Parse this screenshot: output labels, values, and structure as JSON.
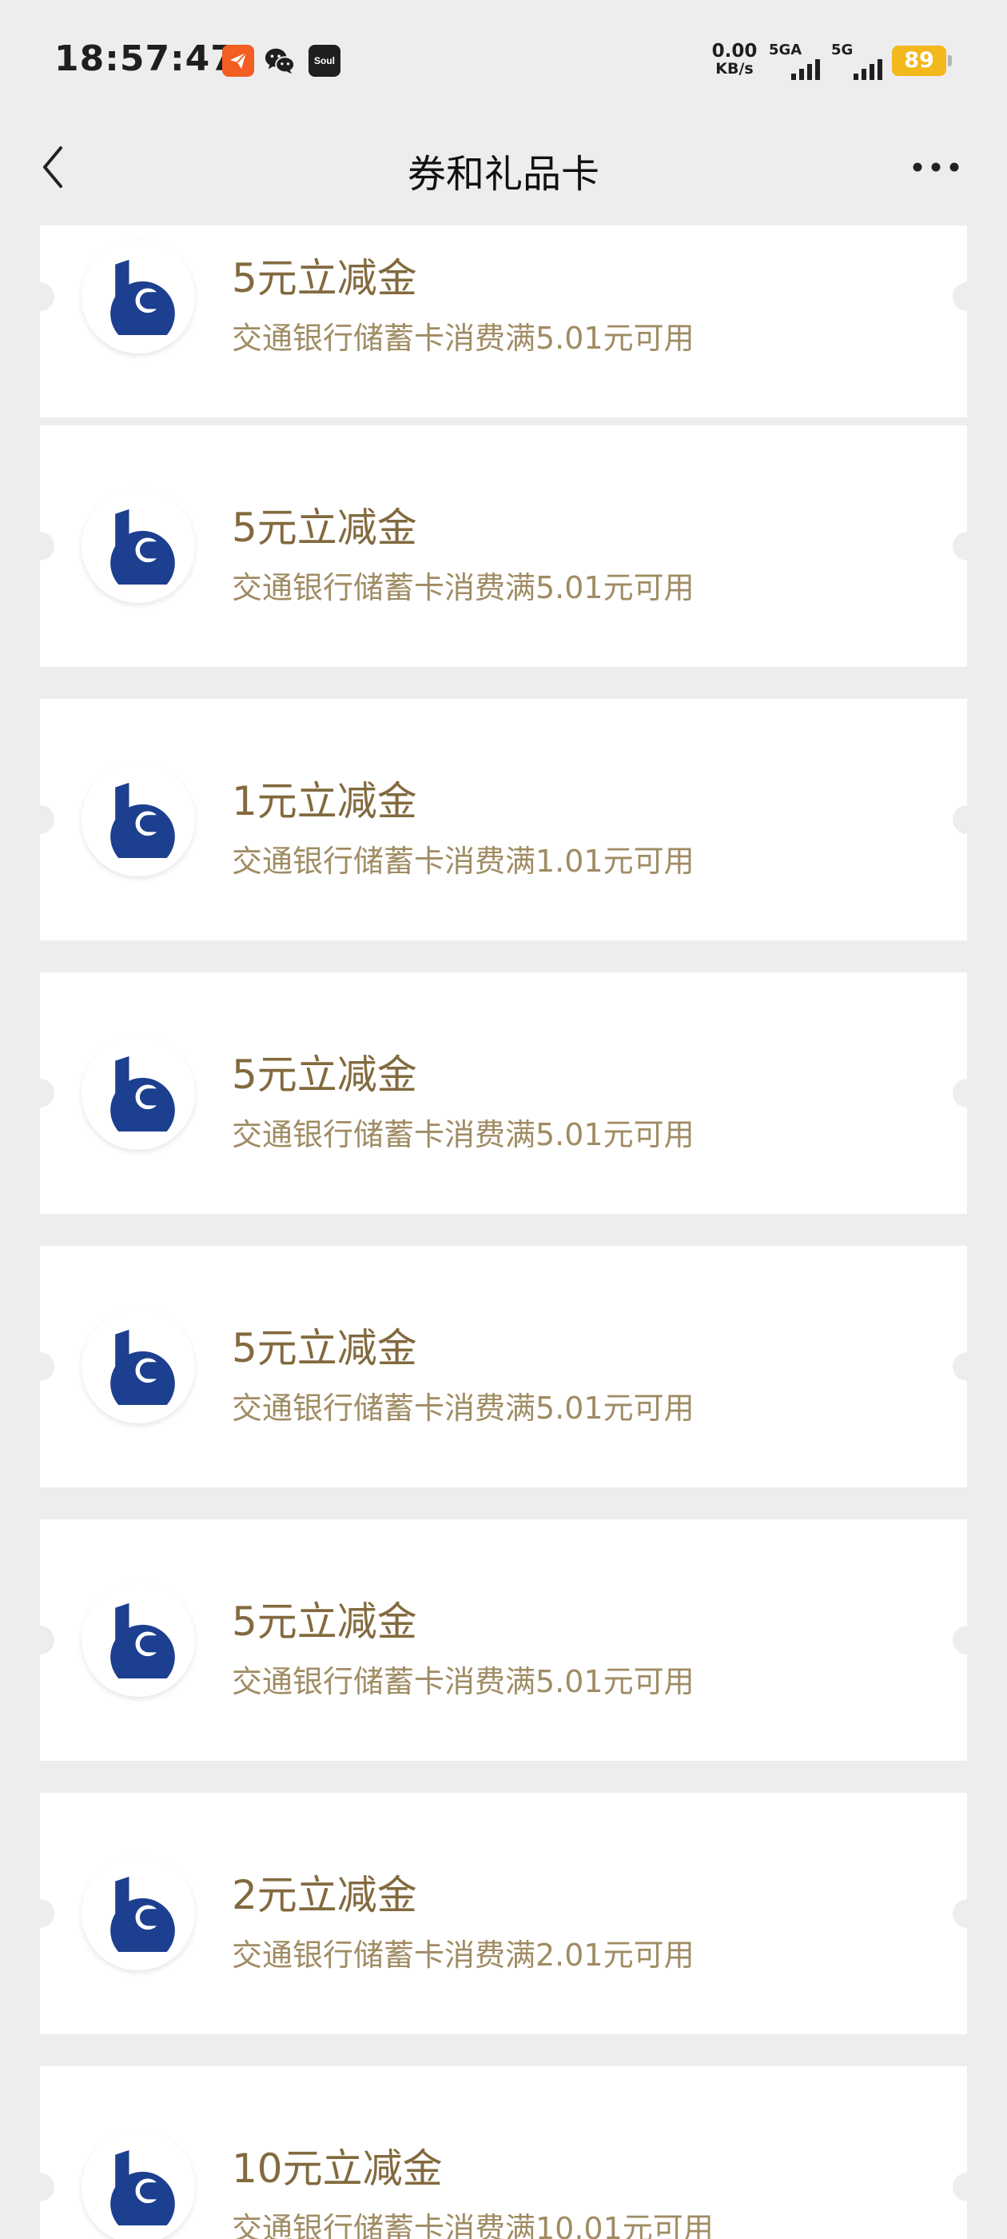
{
  "status_bar": {
    "time": "18:57:47",
    "app_icons": [
      "feishu-icon",
      "wechat-icon",
      "soul-icon"
    ],
    "soul_label": "Soul",
    "net_speed_value": "0.00",
    "net_speed_unit": "KB/s",
    "signal1_label": "5GA",
    "signal2_label": "5G",
    "battery_level": "89",
    "battery_color": "#f3b81c"
  },
  "nav": {
    "title": "券和礼品卡",
    "back_icon": "chevron-left-icon",
    "more_icon": "more-horizontal-icon"
  },
  "theme": {
    "title_color": "#826a3e",
    "desc_color": "#a08c64",
    "logo_color": "#1d3f8f",
    "background": "#ededed"
  },
  "coupons": [
    {
      "title": "5元立减金",
      "desc": "交通银行储蓄卡消费满5.01元可用",
      "logo": "bankcomm-logo-icon"
    },
    {
      "title": "5元立减金",
      "desc": "交通银行储蓄卡消费满5.01元可用",
      "logo": "bankcomm-logo-icon"
    },
    {
      "title": "1元立减金",
      "desc": "交通银行储蓄卡消费满1.01元可用",
      "logo": "bankcomm-logo-icon"
    },
    {
      "title": "5元立减金",
      "desc": "交通银行储蓄卡消费满5.01元可用",
      "logo": "bankcomm-logo-icon"
    },
    {
      "title": "5元立减金",
      "desc": "交通银行储蓄卡消费满5.01元可用",
      "logo": "bankcomm-logo-icon"
    },
    {
      "title": "5元立减金",
      "desc": "交通银行储蓄卡消费满5.01元可用",
      "logo": "bankcomm-logo-icon"
    },
    {
      "title": "2元立减金",
      "desc": "交通银行储蓄卡消费满2.01元可用",
      "logo": "bankcomm-logo-icon"
    },
    {
      "title": "10元立减金",
      "desc": "交通银行储蓄卡消费满10.01元可用",
      "logo": "bankcomm-logo-icon"
    }
  ]
}
